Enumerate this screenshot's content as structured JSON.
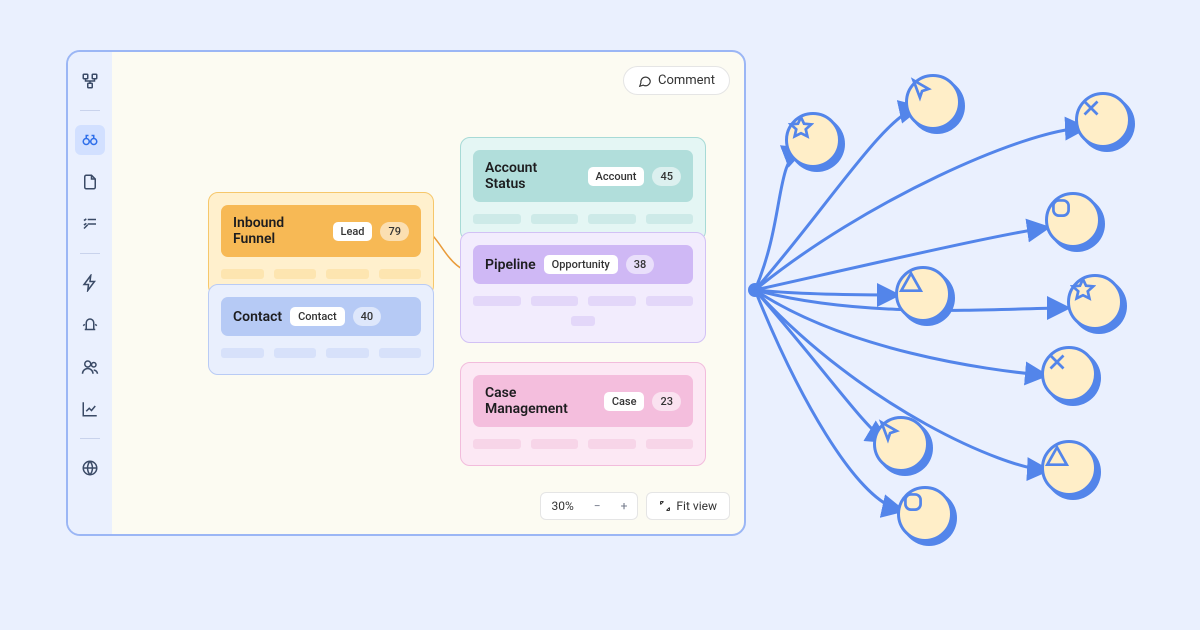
{
  "toolbar": {
    "comment_label": "Comment",
    "fit_view_label": "Fit view",
    "zoom_level": "30%"
  },
  "sidebar": {
    "items": [
      {
        "name": "hierarchy-icon"
      },
      {
        "name": "binoculars-icon"
      },
      {
        "name": "document-icon"
      },
      {
        "name": "checklist-icon"
      },
      {
        "name": "bolt-icon"
      },
      {
        "name": "alert-icon"
      },
      {
        "name": "users-icon"
      },
      {
        "name": "chart-icon"
      },
      {
        "name": "globe-icon"
      }
    ]
  },
  "cards": {
    "inbound_funnel": {
      "title": "Inbound Funnel",
      "badge": "Lead",
      "count": "79"
    },
    "contact": {
      "title": "Contact",
      "badge": "Contact",
      "count": "40"
    },
    "account_status": {
      "title": "Account Status",
      "badge": "Account",
      "count": "45"
    },
    "pipeline": {
      "title": "Pipeline",
      "badge": "Opportunity",
      "count": "38"
    },
    "case_management": {
      "title": "Case Management",
      "badge": "Case",
      "count": "23"
    }
  },
  "burst": {
    "bubbles": [
      {
        "icon": "star"
      },
      {
        "icon": "cursor"
      },
      {
        "icon": "x"
      },
      {
        "icon": "square"
      },
      {
        "icon": "triangle"
      },
      {
        "icon": "star"
      },
      {
        "icon": "x"
      },
      {
        "icon": "cursor"
      },
      {
        "icon": "triangle"
      },
      {
        "icon": "square"
      }
    ]
  }
}
